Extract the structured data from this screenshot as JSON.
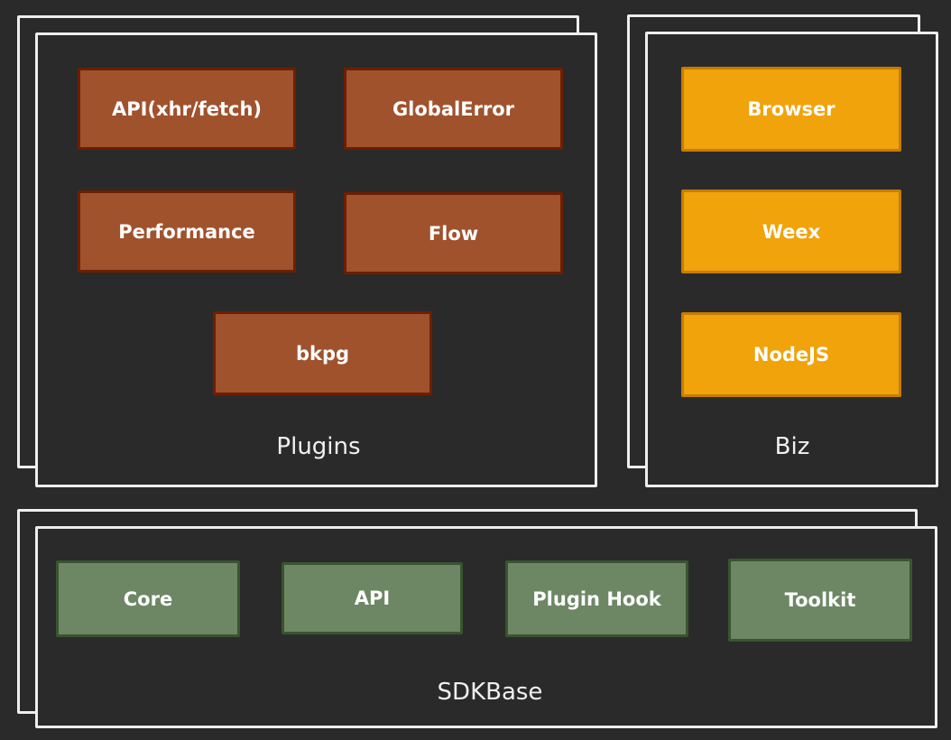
{
  "groups": {
    "plugins": {
      "label": "Plugins",
      "items": [
        "API(xhr/fetch)",
        "GlobalError",
        "Performance",
        "Flow",
        "bkpg"
      ]
    },
    "biz": {
      "label": "Biz",
      "items": [
        "Browser",
        "Weex",
        "NodeJS"
      ]
    },
    "sdkbase": {
      "label": "SDKBase",
      "items": [
        "Core",
        "API",
        "Plugin Hook",
        "Toolkit"
      ]
    }
  },
  "colors": {
    "background": "#2a2a2a",
    "frame_stroke": "#eeeeee",
    "plugin_fill": "#a0522d",
    "plugin_stroke": "#6d1f00",
    "biz_fill": "#f0a30a",
    "biz_stroke": "#c77c02",
    "base_fill": "#6d8764",
    "base_stroke": "#3a5431"
  }
}
